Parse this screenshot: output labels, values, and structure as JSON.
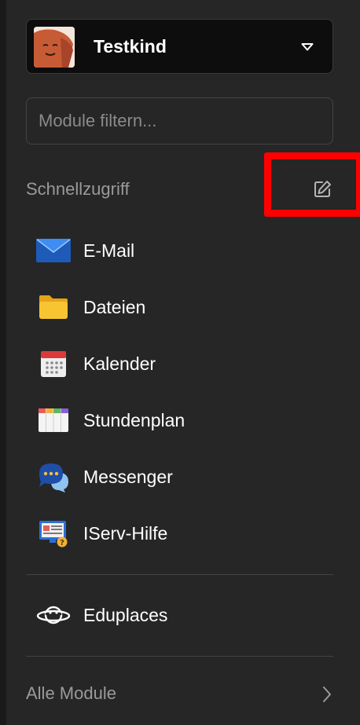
{
  "user": {
    "name": "Testkind",
    "avatar_icon": "avatar-face-icon"
  },
  "filter": {
    "placeholder": "Module filtern...",
    "value": ""
  },
  "quick_access": {
    "label": "Schnellzugriff",
    "edit_icon": "edit-icon",
    "items": [
      {
        "label": "E-Mail",
        "icon": "mail-icon"
      },
      {
        "label": "Dateien",
        "icon": "folder-icon"
      },
      {
        "label": "Kalender",
        "icon": "calendar-icon"
      },
      {
        "label": "Stundenplan",
        "icon": "timetable-icon"
      },
      {
        "label": "Messenger",
        "icon": "messenger-icon"
      },
      {
        "label": "IServ-Hilfe",
        "icon": "help-icon"
      }
    ]
  },
  "extra": {
    "label": "Eduplaces",
    "icon": "planet-icon"
  },
  "all_modules": {
    "label": "Alle Module",
    "icon": "chevron-right-icon"
  },
  "colors": {
    "background": "#262626",
    "highlight": "#ff0000",
    "text": "#ffffff",
    "muted_text": "#9a9a9a"
  }
}
